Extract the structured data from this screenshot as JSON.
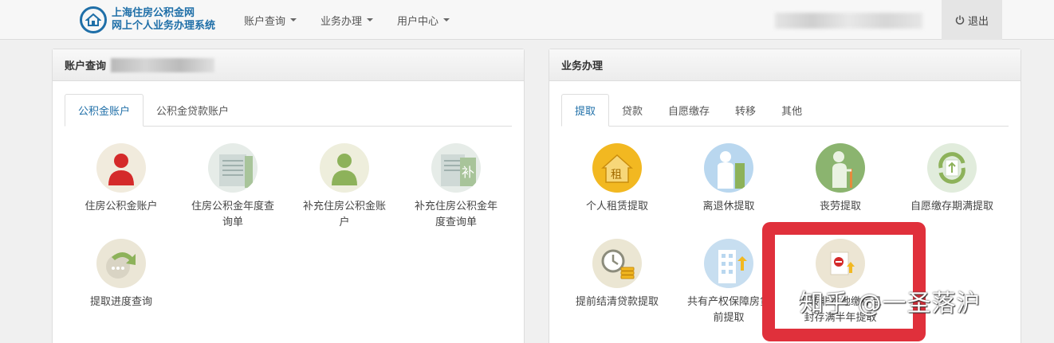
{
  "brand": {
    "line1": "上海住房公积金网",
    "line2": "网上个人业务办理系统"
  },
  "nav": {
    "items": [
      "账户查询",
      "业务办理",
      "用户中心"
    ]
  },
  "logout": "退出",
  "left_panel": {
    "title": "账户查询",
    "tabs": [
      "公积金账户",
      "公积金贷款账户"
    ],
    "tiles": [
      {
        "label": "住房公积金账户",
        "icon": "person-icon"
      },
      {
        "label": "住房公积金年度查询单",
        "icon": "document-icon"
      },
      {
        "label": "补充住房公积金账户",
        "icon": "person-icon"
      },
      {
        "label": "补充住房公积金年度查询单",
        "icon": "document-icon"
      },
      {
        "label": "提取进度查询",
        "icon": "progress-icon"
      }
    ]
  },
  "right_panel": {
    "title": "业务办理",
    "tabs": [
      "提取",
      "贷款",
      "自愿缴存",
      "转移",
      "其他"
    ],
    "tiles": [
      {
        "label": "个人租赁提取",
        "icon": "rent-house-icon"
      },
      {
        "label": "离退休提取",
        "icon": "retire-icon"
      },
      {
        "label": "丧劳提取",
        "icon": "elder-icon"
      },
      {
        "label": "自愿缴存期满提取",
        "icon": "deposit-cycle-icon"
      },
      {
        "label": "提前结清贷款提取",
        "icon": "clock-coins-icon"
      },
      {
        "label": "共有产权保障房贷前提取",
        "icon": "building-icon"
      },
      {
        "label": "外转非本地缴存且封存满半年提取",
        "icon": "seal-document-icon"
      }
    ]
  },
  "watermark": "知乎 @一圣落沪",
  "colors": {
    "brand_blue": "#1f6fa8",
    "highlight_red": "#e0303b"
  }
}
